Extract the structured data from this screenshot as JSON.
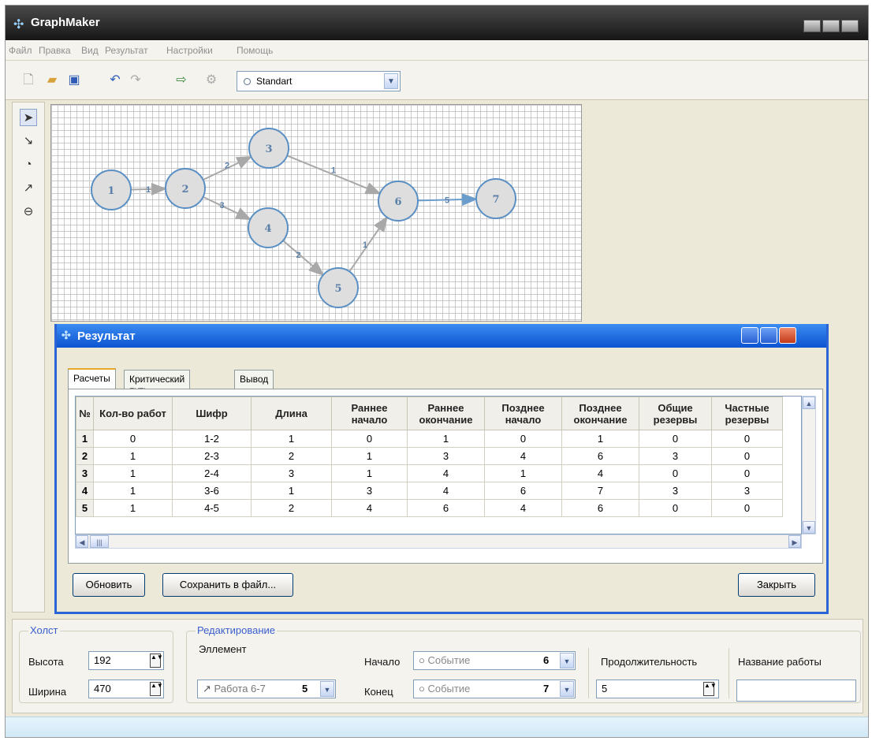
{
  "app": {
    "title": "GraphMaker"
  },
  "menu": [
    "Файл",
    "Правка",
    "Вид",
    "Результат",
    "Настройки",
    "Помощь"
  ],
  "toolbar": {
    "icons": [
      "new-file-icon",
      "open-folder-icon",
      "save-icon",
      "undo-icon",
      "redo-icon",
      "export-icon",
      "settings-gear-icon"
    ],
    "style_select": "Standart"
  },
  "tools": [
    "pointer-tool-icon",
    "pointer-move-tool-icon",
    "add-node-tool-icon",
    "add-edge-tool-icon",
    "delete-tool-icon"
  ],
  "graph": {
    "nodes": [
      "1",
      "2",
      "3",
      "4",
      "5",
      "6",
      "7"
    ],
    "edges": [
      {
        "from": "1",
        "to": "2",
        "label": "1"
      },
      {
        "from": "2",
        "to": "3",
        "label": "2"
      },
      {
        "from": "2",
        "to": "4",
        "label": "3"
      },
      {
        "from": "3",
        "to": "6",
        "label": "1"
      },
      {
        "from": "4",
        "to": "5",
        "label": "2"
      },
      {
        "from": "5",
        "to": "6",
        "label": "1"
      },
      {
        "from": "6",
        "to": "7",
        "label": "5"
      }
    ]
  },
  "result_dialog": {
    "title": "Результат",
    "tabs": [
      "Расчеты",
      "Критический путь",
      "Вывод"
    ],
    "active_tab": "Расчеты",
    "columns": [
      "№",
      "Кол-во работ",
      "Шифр",
      "Длина",
      "Раннее начало",
      "Раннее окончание",
      "Позднее начало",
      "Позднее окончание",
      "Общие резервы",
      "Частные резервы"
    ],
    "rows": [
      [
        "1",
        "0",
        "1-2",
        "1",
        "0",
        "1",
        "0",
        "1",
        "0",
        "0"
      ],
      [
        "2",
        "1",
        "2-3",
        "2",
        "1",
        "3",
        "4",
        "6",
        "3",
        "0"
      ],
      [
        "3",
        "1",
        "2-4",
        "3",
        "1",
        "4",
        "1",
        "4",
        "0",
        "0"
      ],
      [
        "4",
        "1",
        "3-6",
        "1",
        "3",
        "4",
        "6",
        "7",
        "3",
        "3"
      ],
      [
        "5",
        "1",
        "4-5",
        "2",
        "4",
        "6",
        "4",
        "6",
        "0",
        "0"
      ]
    ],
    "buttons": {
      "refresh": "Обновить",
      "save": "Сохранить в файл...",
      "close": "Закрыть"
    }
  },
  "canvas_panel": {
    "legend": "Холст",
    "height_label": "Высота",
    "height_value": "192",
    "width_label": "Ширина",
    "width_value": "470"
  },
  "edit_panel": {
    "legend": "Редактирование",
    "element_label": "Эллемент",
    "element_value": "Работа 6-7",
    "element_number": "5",
    "start_label": "Начало",
    "start_value": "Событие",
    "start_number": "6",
    "end_label": "Конец",
    "end_value": "Событие",
    "end_number": "7",
    "duration_label": "Продолжительность",
    "duration_value": "5",
    "work_name_label": "Название работы",
    "work_name_value": ""
  },
  "colors": {
    "node_stroke": "#5a8fc4",
    "node_fill": "#dedede",
    "edge": "#a8a8a8",
    "label": "#5a7fa8",
    "dialog_title": "#0c53d1"
  }
}
